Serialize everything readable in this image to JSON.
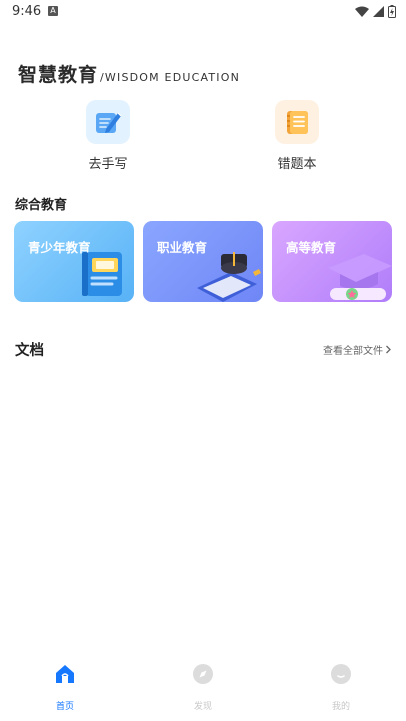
{
  "status_bar": {
    "time": "9:46",
    "notification_badge": "A"
  },
  "header": {
    "title_cn": "智慧教育",
    "title_en": "/WISDOM EDUCATION"
  },
  "tools": [
    {
      "label": "去手写",
      "icon": "pen-writing-icon"
    },
    {
      "label": "错题本",
      "icon": "notebook-icon"
    }
  ],
  "section": {
    "title": "综合教育"
  },
  "cards": [
    {
      "title": "青少年教育",
      "icon": "book-icon"
    },
    {
      "title": "职业教育",
      "icon": "graduation-cap-book-icon"
    },
    {
      "title": "高等教育",
      "icon": "mortarboard-icon"
    }
  ],
  "documents": {
    "title": "文档",
    "view_all": "查看全部文件"
  },
  "bottom_nav": [
    {
      "label": "首页",
      "icon": "home-icon",
      "active": true
    },
    {
      "label": "发现",
      "icon": "compass-icon",
      "active": false
    },
    {
      "label": "我的",
      "icon": "user-icon",
      "active": false
    }
  ],
  "colors": {
    "accent": "#1677ff",
    "inactive": "#c8c8c8"
  }
}
